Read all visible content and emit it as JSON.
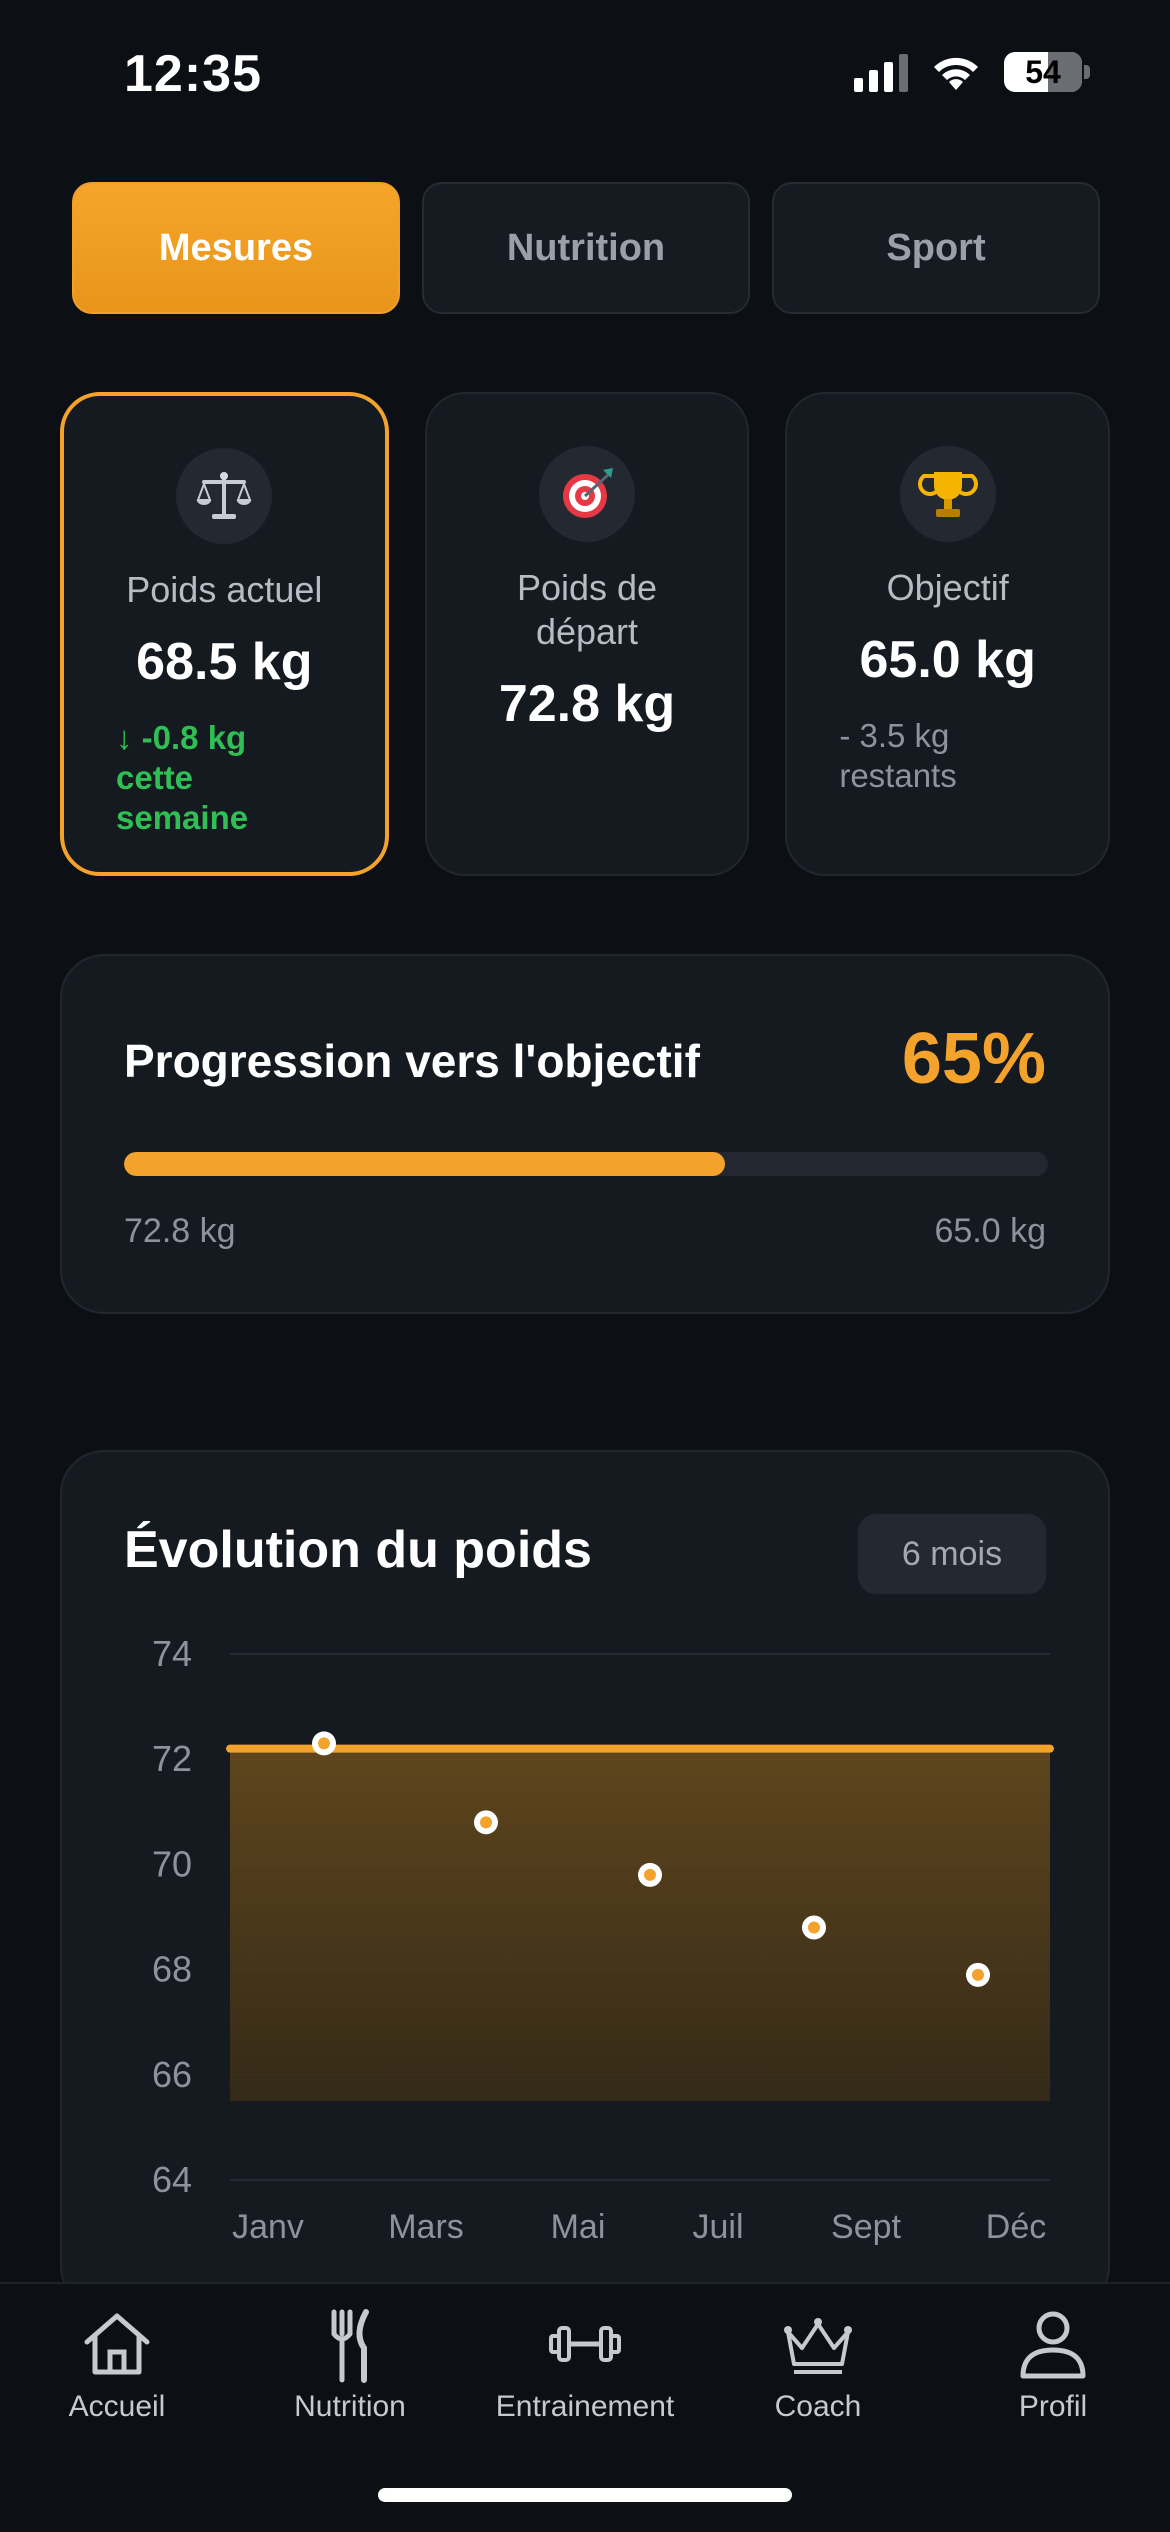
{
  "status": {
    "time": "12:35",
    "battery": "54"
  },
  "tabs": [
    {
      "label": "Mesures",
      "active": true
    },
    {
      "label": "Nutrition",
      "active": false
    },
    {
      "label": "Sport",
      "active": false
    }
  ],
  "stats": {
    "current": {
      "label": "Poids actuel",
      "value": "68.5 kg",
      "note_lines": [
        "↓ -0.8 kg",
        "cette",
        "semaine"
      ],
      "icon": "scale-icon"
    },
    "start": {
      "label_lines": [
        "Poids de",
        "départ"
      ],
      "value": "72.8 kg",
      "icon": "target-icon"
    },
    "goal": {
      "label": "Objectif",
      "value": "65.0 kg",
      "note_lines": [
        "- 3.5 kg",
        "restants"
      ],
      "icon": "trophy-icon"
    }
  },
  "progress": {
    "title": "Progression vers l'objectif",
    "percent_label": "65%",
    "percent": 65,
    "start_label": "72.8 kg",
    "end_label": "65.0 kg"
  },
  "chart": {
    "title": "Évolution du poids",
    "range_label": "6 mois"
  },
  "chart_data": {
    "type": "area",
    "title": "Évolution du poids",
    "xlabel": "",
    "ylabel": "",
    "x_tick_labels": [
      "Janv",
      "Mars",
      "Mai",
      "Juil",
      "Sept",
      "Déc"
    ],
    "y_ticks": [
      74,
      72,
      70,
      68,
      66,
      64
    ],
    "ylim": [
      64,
      74
    ],
    "series": [
      {
        "name": "",
        "type": "area",
        "x_index": [
          0,
          5
        ],
        "values": [
          72.2,
          72.2
        ],
        "color": "#f3a32c"
      },
      {
        "name": "",
        "type": "scatter",
        "x": [
          "Févr",
          "Avr",
          "Juin",
          "Août",
          "Oct"
        ],
        "values": [
          72.3,
          70.8,
          69.8,
          68.8,
          67.9
        ],
        "color": "#f3a32c"
      }
    ],
    "grid": true,
    "legend": "none"
  },
  "nav": [
    {
      "label": "Accueil",
      "icon": "home-icon"
    },
    {
      "label": "Nutrition",
      "icon": "fork-knife-icon"
    },
    {
      "label": "Entrainement",
      "icon": "dumbbell-icon"
    },
    {
      "label": "Coach",
      "icon": "crown-icon"
    },
    {
      "label": "Profil",
      "icon": "profile-icon"
    }
  ],
  "colors": {
    "accent": "#f3a32c",
    "success": "#2fbf55",
    "background": "#0c0f14",
    "card": "#151920"
  }
}
